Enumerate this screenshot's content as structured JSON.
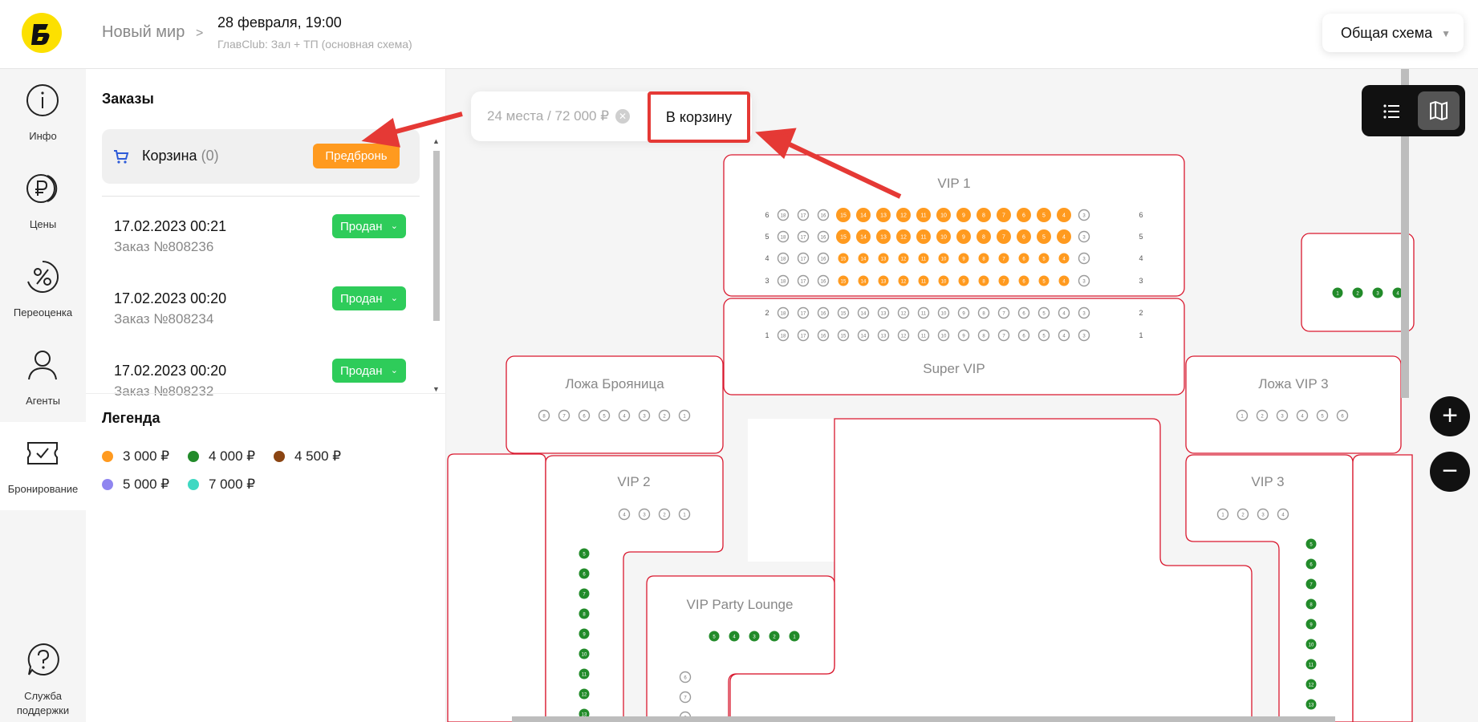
{
  "header": {
    "event_name": "Новый мир",
    "date": "28 февраля, 19:00",
    "hall": "ГлавClub: Зал + ТП (основная схема)",
    "schema_select": "Общая схема"
  },
  "nav": {
    "items": [
      {
        "label": "Инфо",
        "icon": "info-icon"
      },
      {
        "label": "Цены",
        "icon": "ruble-coin-icon"
      },
      {
        "label": "Переоценка",
        "icon": "percent-icon"
      },
      {
        "label": "Агенты",
        "icon": "person-icon"
      },
      {
        "label": "Бронирование",
        "icon": "ticket-icon",
        "active": true
      }
    ],
    "support": {
      "line1": "Служба",
      "line2": "поддержки",
      "icon": "help-icon"
    }
  },
  "orders": {
    "title": "Заказы",
    "cart_label": "Корзина",
    "cart_count": "(0)",
    "prebook_button": "Предбронь",
    "list": [
      {
        "datetime": "17.02.2023 00:21",
        "number": "Заказ №808236",
        "status": "Продан"
      },
      {
        "datetime": "17.02.2023 00:20",
        "number": "Заказ №808234",
        "status": "Продан"
      },
      {
        "datetime": "17.02.2023 00:20",
        "number": "Заказ №808232",
        "status": "Продан"
      }
    ]
  },
  "legend": {
    "title": "Легенда",
    "items": [
      {
        "label": "3 000 ₽",
        "color": "#ff9a1f"
      },
      {
        "label": "4 000 ₽",
        "color": "#228b2a"
      },
      {
        "label": "4 500 ₽",
        "color": "#8b4513"
      },
      {
        "label": "5 000 ₽",
        "color": "#8f85f0"
      },
      {
        "label": "7 000 ₽",
        "color": "#3fd8c2"
      }
    ]
  },
  "selection": {
    "info": "24 места / 72 000 ₽",
    "to_cart_button": "В корзину"
  },
  "zoom": {
    "in": "+",
    "out": "−"
  },
  "map": {
    "sections": {
      "vip1": "VIP 1",
      "super_vip": "Super VIP",
      "loge_bronnitsa": "Ложа Брояница",
      "loge_vip3": "Ложа VIP 3",
      "vip2": "VIP 2",
      "vip3": "VIP 3",
      "vip_party_lounge": "VIP Party Lounge"
    }
  },
  "colors": {
    "sold": "#2ecc5a",
    "prebook": "#ff9a1f",
    "highlight": "#e53935",
    "section_border": "#d9182e"
  }
}
